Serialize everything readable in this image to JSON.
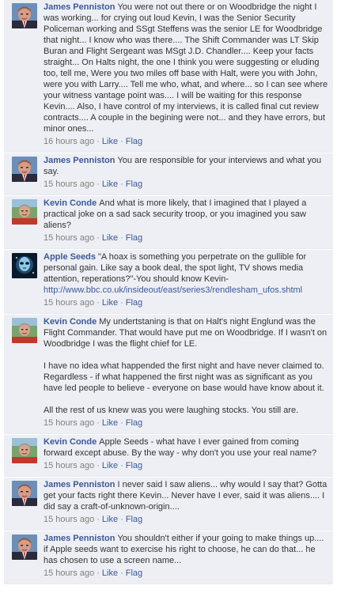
{
  "comments": [
    {
      "author": "James Penniston",
      "avatar": "james",
      "paragraphs": [
        "You were not out there or on Woodbridge the night I was working... for crying out loud Kevin, I was the Senior Security Policeman working and SSgt Steffens was the senior LE for Woodbridge that night... I know who was there.... The Shift Commander was LT Skip Buran and Flight Sergeant was MSgt J.D. Chandler.... Keep your facts straight... On Halts night, the one I think you were suggesting or eluding too, tell me, Were you two miles off base with Halt, were you with John, were you with Larry.... Tell me who, what, and where... so I can see where your witness vantage point was.... I will be waiting for this response Kevin.... Also, I have control of my interviews, it is called final cut review contracts.... A couple in the begining were not... and they have errors, but minor ones..."
      ],
      "time": "16 hours ago",
      "like": "Like",
      "flag": "Flag"
    },
    {
      "author": "James Penniston",
      "avatar": "james",
      "paragraphs": [
        "You are responsible for your interviews and what you say."
      ],
      "time": "15 hours ago",
      "like": "Like",
      "flag": "Flag"
    },
    {
      "author": "Kevin Conde",
      "avatar": "kevin",
      "paragraphs": [
        "And what is more likely, that I imagined that I played a practical joke on a sad sack security troop, or you imagined you saw aliens?"
      ],
      "time": "15 hours ago",
      "like": "Like",
      "flag": "Flag"
    },
    {
      "author": "Apple Seeds",
      "avatar": "apple",
      "paragraphs": [
        "\"A hoax is something you perpetrate on the gullible for personal gain. Like say a book deal, the spot light, TV shows media attention, reperations?\"-You should know Kevin-"
      ],
      "link": "http://www.bbc.co.uk/insideout/east/series3/rendlesham_ufos.shtml",
      "time": "15 hours ago",
      "like": "Like",
      "flag": "Flag"
    },
    {
      "author": "Kevin Conde",
      "avatar": "kevin",
      "paragraphs": [
        "My undertstaning is that on Halt's night Englund was the Flight Commander. That would have put me on Woodbridge. If I wasn't on Woodbridge I was the flight chief for LE.",
        "I have no idea what happended the first night and have never claimed to. Regardless - if what happened the first night was as significant as you have led people to believe - everyone on base would have know about it.",
        "All the rest of us knew was you were laughing stocks. You still are."
      ],
      "time": "15 hours ago",
      "like": "Like",
      "flag": "Flag"
    },
    {
      "author": "Kevin Conde",
      "avatar": "kevin",
      "paragraphs": [
        "Apple Seeds - what have I ever gained from coming forward except abuse. By the way - why don't you use your real name?"
      ],
      "time": "15 hours ago",
      "like": "Like",
      "flag": "Flag"
    },
    {
      "author": "James Penniston",
      "avatar": "james",
      "paragraphs": [
        "I never said I saw aliens... why would I say that? Gotta get your facts right there Kevin... Never have I ever, said it was aliens.... I did say a craft-of-unknown-origin...."
      ],
      "time": "15 hours ago",
      "like": "Like",
      "flag": "Flag"
    },
    {
      "author": "James Penniston",
      "avatar": "james",
      "paragraphs": [
        "You shouldn't either if your going to make things up.... if Apple seeds want to exercise his right to choose, he can do that... he has chosen to use a screen name..."
      ],
      "time": "15 hours ago",
      "like": "Like",
      "flag": "Flag"
    }
  ]
}
